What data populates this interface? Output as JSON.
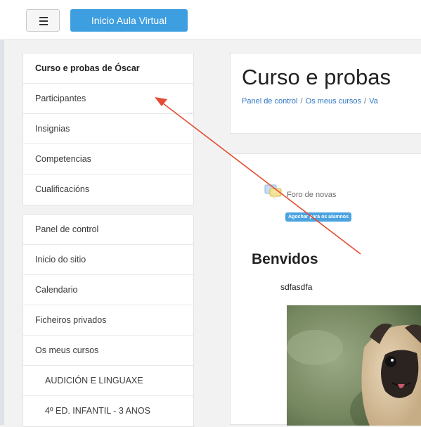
{
  "topbar": {
    "home_label": "Inicio Aula Virtual"
  },
  "sidebar": {
    "course_block": [
      {
        "label": "Curso e probas de Óscar"
      },
      {
        "label": "Participantes"
      },
      {
        "label": "Insignias"
      },
      {
        "label": "Competencias"
      },
      {
        "label": "Cualificacións"
      }
    ],
    "site_block": [
      {
        "label": "Panel de control"
      },
      {
        "label": "Inicio do sitio"
      },
      {
        "label": "Calendario"
      },
      {
        "label": "Ficheiros privados"
      },
      {
        "label": "Os meus cursos"
      },
      {
        "label": "AUDICIÓN E LINGUAXE"
      },
      {
        "label": "4º ED. INFANTIL - 3 ANOS"
      }
    ]
  },
  "header": {
    "course_title": "Curso e probas",
    "breadcrumb": [
      "Panel de control",
      "Os meus cursos",
      "Va"
    ]
  },
  "content": {
    "forum_link": "Foro de novas",
    "badge": "Agochar para os alumnos",
    "section_title": "Benvidos",
    "section_description": "sdfasdfa"
  },
  "colors": {
    "accent": "#3d9ee0",
    "link": "#2f76c2",
    "annotation_arrow": "#e34c32"
  }
}
